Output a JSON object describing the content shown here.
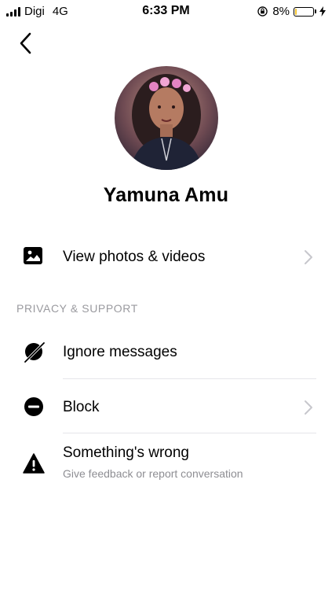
{
  "status_bar": {
    "carrier": "Digi",
    "network": "4G",
    "time": "6:33 PM",
    "battery": "8%",
    "battery_level": 0.08,
    "icons": [
      "signal-bars-icon",
      "orientation-lock-icon",
      "battery-icon",
      "charging-bolt-icon"
    ]
  },
  "header": {
    "back_icon": "chevron-left-icon"
  },
  "profile": {
    "name": "Yamuna Amu"
  },
  "media": {
    "label": "View photos & videos",
    "icon": "photo-icon"
  },
  "privacy": {
    "section_title": "PRIVACY & SUPPORT",
    "ignore_label": "Ignore messages",
    "block_label": "Block",
    "report_label": "Something's wrong",
    "report_sub": "Give feedback or report conversation",
    "icons": [
      "ignore-icon",
      "block-icon",
      "warning-icon"
    ]
  },
  "colors": {
    "text": "#000000",
    "secondary": "#8e8e93",
    "chevron": "#c7c7cc",
    "battery_fill": "#f4c430"
  }
}
